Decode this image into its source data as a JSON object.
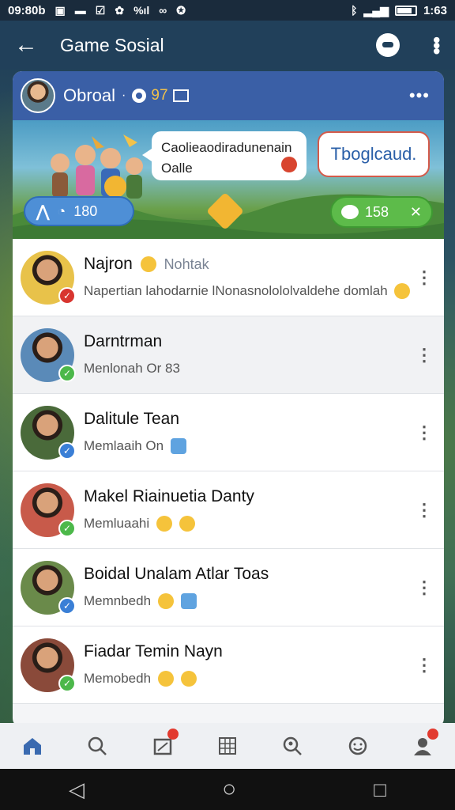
{
  "status_bar": {
    "time_left": "09:80b",
    "time_right": "1:63",
    "icons_left": [
      "image-icon",
      "minus-icon",
      "check-icon",
      "fan-icon",
      "signal-icon",
      "glasses-icon",
      "app-icon",
      "at-icon"
    ],
    "icons_right": [
      "bluetooth-icon",
      "signal-icon",
      "battery-icon"
    ]
  },
  "app_bar": {
    "title": "Game Sosial",
    "back_icon": "arrow-left-icon",
    "chat_icon": "chat-bubble-icon",
    "more_icon": "more-vertical-icon"
  },
  "profile": {
    "name": "Obroal",
    "separator": "·",
    "score": "97",
    "menu_icon": "more-horizontal-icon"
  },
  "banner": {
    "speech_text": "Caolieaodiradunenain Oalle",
    "tag_text": "Tboglcaud.",
    "left_pill_count": "180",
    "right_pill_count": "158",
    "right_pill_close": "✕"
  },
  "players": [
    {
      "name": "Najron",
      "extra": "Nohtak",
      "message": "Napertian lahodarnie lNonasnolololvaldehe domlah",
      "badge": "red"
    },
    {
      "name": "Darntrman",
      "extra": "",
      "message": "Menlonah  Or 83",
      "badge": "green"
    },
    {
      "name": "Dalitule Tean",
      "extra": "",
      "message": "Memlaaih  On",
      "badge": "blue"
    },
    {
      "name": "Makel Riainuetia Danty",
      "extra": "",
      "message": "Memluaahi",
      "badge": "green"
    },
    {
      "name": "Boidal Unalam Atlar Toas",
      "extra": "",
      "message": "Memnbedh",
      "badge": "blue"
    },
    {
      "name": "Fiadar Temin Nayn",
      "extra": "",
      "message": "Memobedh",
      "badge": "green"
    }
  ],
  "colors": {
    "app_bar": "#21405a",
    "profile_header": "#3a5fa6",
    "badge_green": "#4cb84a",
    "badge_blue": "#3a7fd6",
    "badge_red": "#d8352f"
  },
  "bottom_nav": [
    "home-icon",
    "search-icon",
    "notification-icon",
    "grid-icon",
    "search-people-icon",
    "emoji-icon",
    "profile-icon"
  ],
  "system_nav": {
    "back": "◁",
    "home": "○",
    "recent": "□"
  }
}
